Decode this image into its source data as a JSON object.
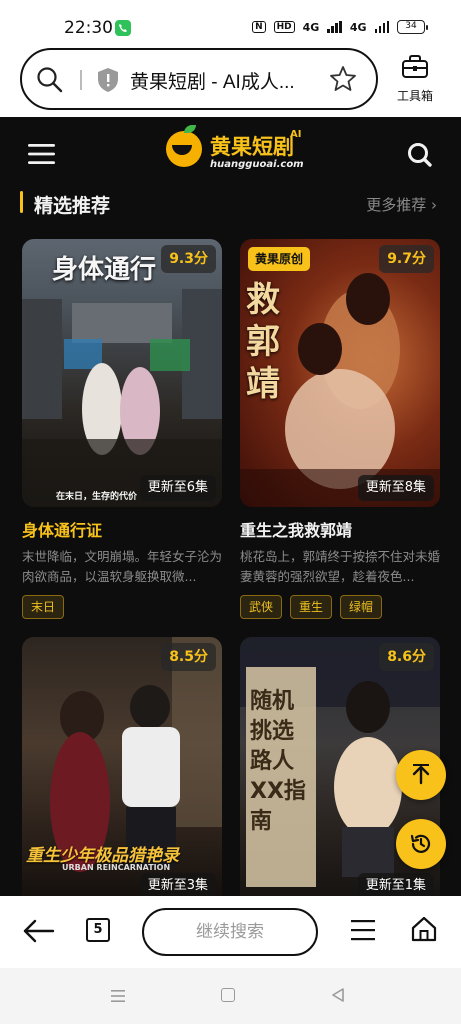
{
  "status_bar": {
    "time": "22:30",
    "nfc": "N",
    "hd": "HD",
    "network1": "4G",
    "network2": "4G",
    "battery": "34"
  },
  "browser": {
    "page_title": "黄果短剧 - AI成人...",
    "toolbox_label": "工具箱",
    "tab_count": "5",
    "continue_search": "继续搜索"
  },
  "site": {
    "logo_text": "黄果短剧",
    "logo_ai": "AI",
    "logo_domain": "huangguoai.com"
  },
  "section": {
    "title": "精选推荐",
    "more": "更多推荐 ›"
  },
  "cards": [
    {
      "score": "9.3分",
      "episodes": "更新至6集",
      "poster_title": "身体通行",
      "poster_caption": "在末日，生存的代价",
      "title": "身体通行证",
      "desc": "末世降临，文明崩塌。年轻女子沦为肉欲商品，以温软身躯换取微...",
      "tags": [
        "末日"
      ],
      "title_color": "#f8c21a"
    },
    {
      "badge": "黄果原创",
      "score": "9.7分",
      "episodes": "更新至8集",
      "poster_title": "救郭靖",
      "title": "重生之我救郭靖",
      "desc": "桃花岛上，郭靖终于按捺不住对未婚妻黄蓉的强烈欲望，趁着夜色...",
      "tags": [
        "武侠",
        "重生",
        "绿帽"
      ],
      "title_color": "#f2f2f2"
    },
    {
      "score": "8.5分",
      "episodes": "更新至3集",
      "poster_title": "重生少年极品猎艳录",
      "poster_subtitle": "URBAN REINCARNATION"
    },
    {
      "score": "8.6分",
      "episodes": "更新至1集",
      "poster_title": "随机挑选路人XX指南"
    }
  ],
  "icons": [
    "search-icon",
    "shield-icon",
    "star-icon",
    "toolbox-icon",
    "menu-icon",
    "upload-icon",
    "history-icon",
    "back-arrow-icon",
    "home-icon"
  ],
  "colors": {
    "accent": "#f8c21a",
    "page_bg": "#0d0d0d"
  }
}
